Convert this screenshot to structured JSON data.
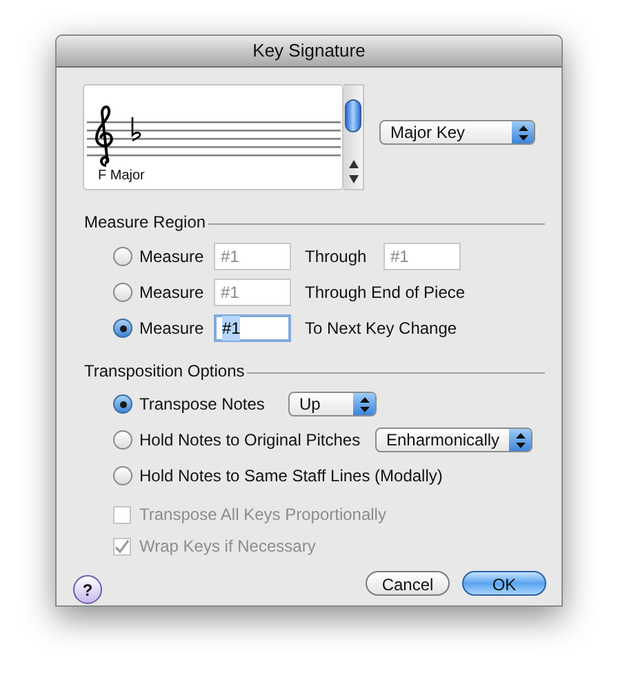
{
  "window": {
    "title": "Key Signature"
  },
  "key_preview": {
    "caption": "F Major"
  },
  "mode_select": {
    "value": "Major Key"
  },
  "measure_region": {
    "title": "Measure Region",
    "options": [
      {
        "label": "Measure",
        "selected": false,
        "from": "#1",
        "to_label": "Through",
        "to": "#1"
      },
      {
        "label": "Measure",
        "selected": false,
        "from": "#1",
        "to_label": "Through End of Piece"
      },
      {
        "label": "Measure",
        "selected": true,
        "from": "#1",
        "to_label": "To Next Key Change"
      }
    ]
  },
  "transposition": {
    "title": "Transposition Options",
    "options": [
      {
        "label": "Transpose Notes",
        "selected": true,
        "select": "Up"
      },
      {
        "label": "Hold Notes to Original Pitches",
        "selected": false,
        "select": "Enharmonically"
      },
      {
        "label": "Hold Notes to Same Staff Lines (Modally)",
        "selected": false
      }
    ],
    "checkboxes": [
      {
        "label": "Transpose All Keys Proportionally",
        "checked": false,
        "disabled": true
      },
      {
        "label": "Wrap Keys if Necessary",
        "checked": true,
        "disabled": true
      }
    ]
  },
  "help": "?",
  "buttons": [
    {
      "label": "Cancel",
      "kind": "normal"
    },
    {
      "label": "OK",
      "kind": "default"
    }
  ]
}
